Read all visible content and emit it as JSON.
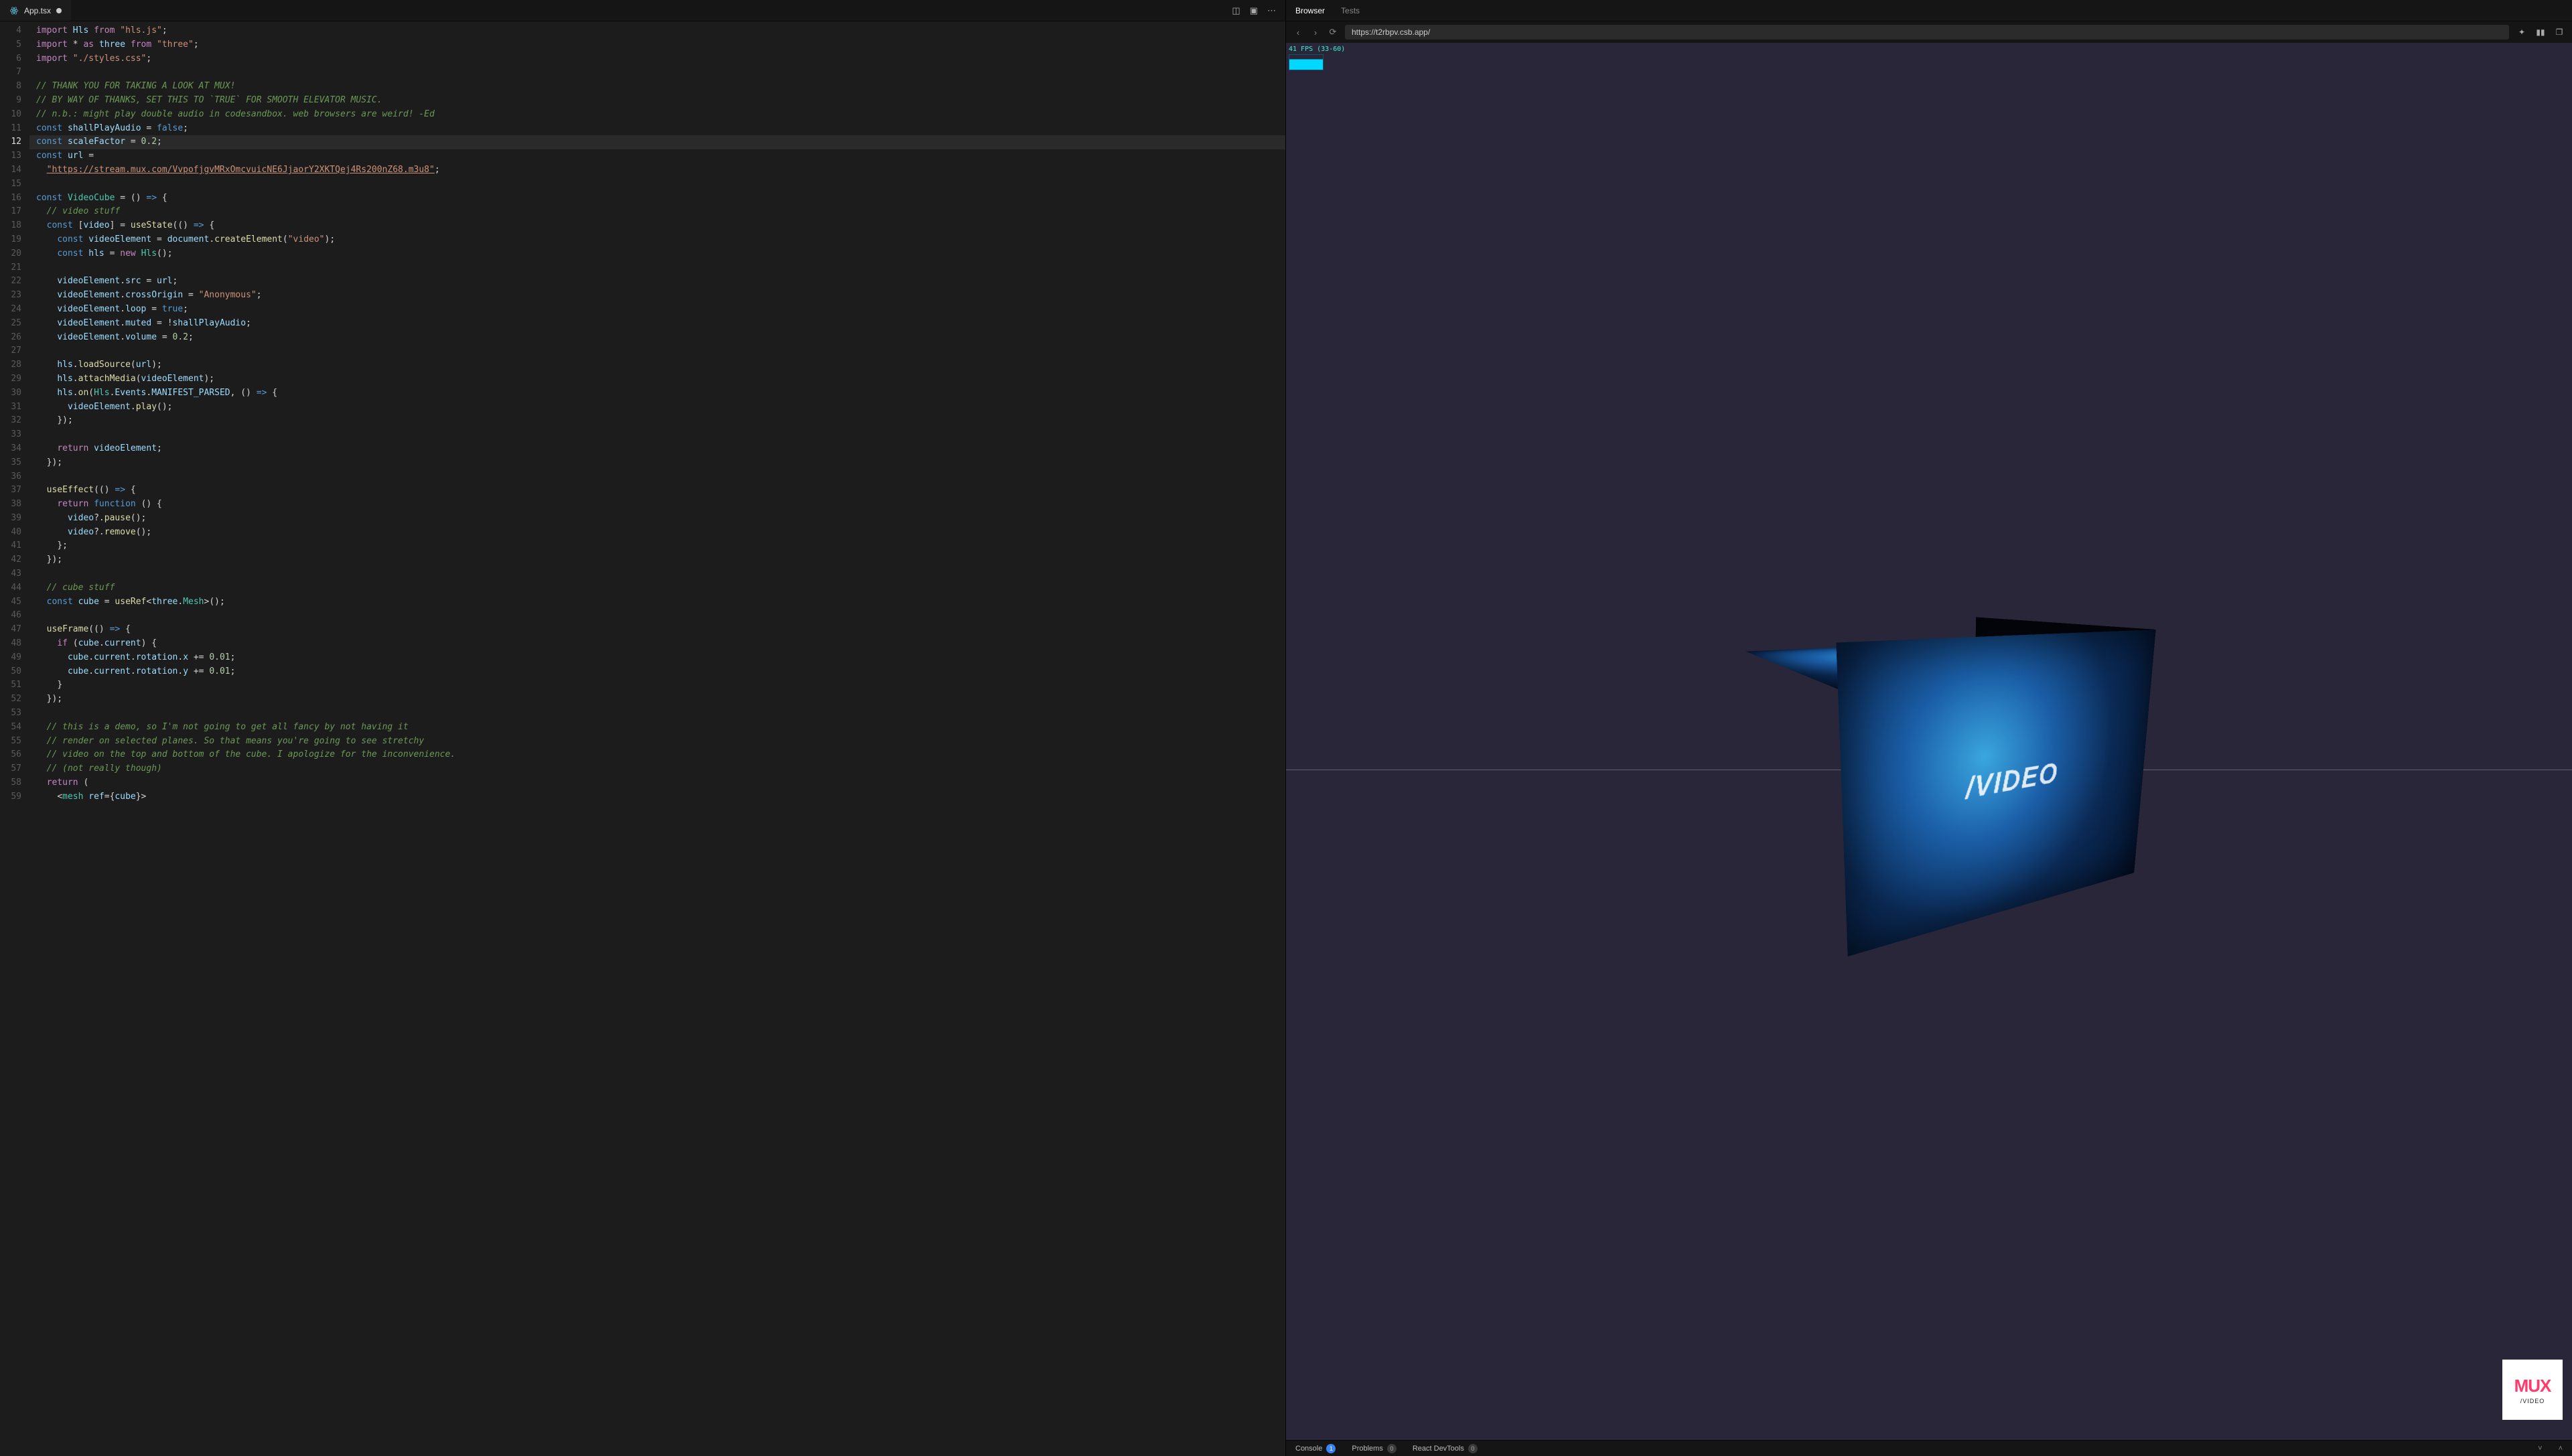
{
  "editor": {
    "tab": {
      "filename": "App.tsx",
      "modified": true
    },
    "activeLine": 12,
    "firstLine": 4,
    "lines": [
      {
        "n": 4,
        "html": "<span class='kw'>import</span> <span class='id'>Hls</span> <span class='kw'>from</span> <span class='str'>\"hls.js\"</span><span class='op'>;</span>"
      },
      {
        "n": 5,
        "html": "<span class='kw'>import</span> <span class='op'>*</span> <span class='kw'>as</span> <span class='id'>three</span> <span class='kw'>from</span> <span class='str'>\"three\"</span><span class='op'>;</span>"
      },
      {
        "n": 6,
        "html": "<span class='kw'>import</span> <span class='str'>\"./styles.css\"</span><span class='op'>;</span>"
      },
      {
        "n": 7,
        "html": ""
      },
      {
        "n": 8,
        "html": "<span class='com'>// THANK YOU FOR TAKING A LOOK AT MUX!</span>"
      },
      {
        "n": 9,
        "html": "<span class='com'>// BY WAY OF THANKS, SET THIS TO `TRUE` FOR SMOOTH ELEVATOR MUSIC.</span>"
      },
      {
        "n": 10,
        "html": "<span class='com'>// n.b.: might play double audio in codesandbox. web browsers are weird! -Ed</span>"
      },
      {
        "n": 11,
        "html": "<span class='kw2'>const</span> <span class='id'>shallPlayAudio</span> <span class='op'>=</span> <span class='kw2'>false</span><span class='op'>;</span>"
      },
      {
        "n": 12,
        "html": "<span class='kw2'>const</span> <span class='id'>scaleFactor</span> <span class='op'>=</span> <span class='num'>0.2</span><span class='op'>;</span>"
      },
      {
        "n": 13,
        "html": "<span class='kw2'>const</span> <span class='id'>url</span> <span class='op'>=</span>"
      },
      {
        "n": 14,
        "html": "  <span class='str url'>\"https://stream.mux.com/VvpofjgvMRxOmcvuicNE6JjaorY2XKTQej4Rs200nZ68.m3u8\"</span><span class='op'>;</span>"
      },
      {
        "n": 15,
        "html": ""
      },
      {
        "n": 16,
        "html": "<span class='kw2'>const</span> <span class='type'>VideoCube</span> <span class='op'>=</span> <span class='op'>()</span> <span class='kw2'>=&gt;</span> <span class='op'>{</span>"
      },
      {
        "n": 17,
        "html": "  <span class='com'>// video stuff</span>"
      },
      {
        "n": 18,
        "html": "  <span class='kw2'>const</span> <span class='op'>[</span><span class='id'>video</span><span class='op'>]</span> <span class='op'>=</span> <span class='fn'>useState</span><span class='op'>(()</span> <span class='kw2'>=&gt;</span> <span class='op'>{</span>"
      },
      {
        "n": 19,
        "html": "    <span class='kw2'>const</span> <span class='id'>videoElement</span> <span class='op'>=</span> <span class='id'>document</span><span class='op'>.</span><span class='fn'>createElement</span><span class='op'>(</span><span class='str'>\"video\"</span><span class='op'>);</span>"
      },
      {
        "n": 20,
        "html": "    <span class='kw2'>const</span> <span class='id'>hls</span> <span class='op'>=</span> <span class='kw'>new</span> <span class='type'>Hls</span><span class='op'>();</span>"
      },
      {
        "n": 21,
        "html": ""
      },
      {
        "n": 22,
        "html": "    <span class='id'>videoElement</span><span class='op'>.</span><span class='id'>src</span> <span class='op'>=</span> <span class='id'>url</span><span class='op'>;</span>"
      },
      {
        "n": 23,
        "html": "    <span class='id'>videoElement</span><span class='op'>.</span><span class='id'>crossOrigin</span> <span class='op'>=</span> <span class='str'>\"Anonymous\"</span><span class='op'>;</span>"
      },
      {
        "n": 24,
        "html": "    <span class='id'>videoElement</span><span class='op'>.</span><span class='id'>loop</span> <span class='op'>=</span> <span class='kw2'>true</span><span class='op'>;</span>"
      },
      {
        "n": 25,
        "html": "    <span class='id'>videoElement</span><span class='op'>.</span><span class='id'>muted</span> <span class='op'>=</span> <span class='op'>!</span><span class='id'>shallPlayAudio</span><span class='op'>;</span>"
      },
      {
        "n": 26,
        "html": "    <span class='id'>videoElement</span><span class='op'>.</span><span class='id'>volume</span> <span class='op'>=</span> <span class='num'>0.2</span><span class='op'>;</span>"
      },
      {
        "n": 27,
        "html": ""
      },
      {
        "n": 28,
        "html": "    <span class='id'>hls</span><span class='op'>.</span><span class='fn'>loadSource</span><span class='op'>(</span><span class='id'>url</span><span class='op'>);</span>"
      },
      {
        "n": 29,
        "html": "    <span class='id'>hls</span><span class='op'>.</span><span class='fn'>attachMedia</span><span class='op'>(</span><span class='id'>videoElement</span><span class='op'>);</span>"
      },
      {
        "n": 30,
        "html": "    <span class='id'>hls</span><span class='op'>.</span><span class='fn'>on</span><span class='op'>(</span><span class='type'>Hls</span><span class='op'>.</span><span class='id'>Events</span><span class='op'>.</span><span class='id'>MANIFEST_PARSED</span><span class='op'>, ()</span> <span class='kw2'>=&gt;</span> <span class='op'>{</span>"
      },
      {
        "n": 31,
        "html": "      <span class='id'>videoElement</span><span class='op'>.</span><span class='fn'>play</span><span class='op'>();</span>"
      },
      {
        "n": 32,
        "html": "    <span class='op'>});</span>"
      },
      {
        "n": 33,
        "html": ""
      },
      {
        "n": 34,
        "html": "    <span class='kw'>return</span> <span class='id'>videoElement</span><span class='op'>;</span>"
      },
      {
        "n": 35,
        "html": "  <span class='op'>});</span>"
      },
      {
        "n": 36,
        "html": ""
      },
      {
        "n": 37,
        "html": "  <span class='fn'>useEffect</span><span class='op'>(()</span> <span class='kw2'>=&gt;</span> <span class='op'>{</span>"
      },
      {
        "n": 38,
        "html": "    <span class='kw'>return</span> <span class='kw2'>function</span> <span class='op'>() {</span>"
      },
      {
        "n": 39,
        "html": "      <span class='id'>video</span><span class='op'>?.</span><span class='fn'>pause</span><span class='op'>();</span>"
      },
      {
        "n": 40,
        "html": "      <span class='id'>video</span><span class='op'>?.</span><span class='fn'>remove</span><span class='op'>();</span>"
      },
      {
        "n": 41,
        "html": "    <span class='op'>};</span>"
      },
      {
        "n": 42,
        "html": "  <span class='op'>});</span>"
      },
      {
        "n": 43,
        "html": ""
      },
      {
        "n": 44,
        "html": "  <span class='com'>// cube stuff</span>"
      },
      {
        "n": 45,
        "html": "  <span class='kw2'>const</span> <span class='id'>cube</span> <span class='op'>=</span> <span class='fn'>useRef</span><span class='op'>&lt;</span><span class='id'>three</span><span class='op'>.</span><span class='type'>Mesh</span><span class='op'>&gt;();</span>"
      },
      {
        "n": 46,
        "html": ""
      },
      {
        "n": 47,
        "html": "  <span class='fn'>useFrame</span><span class='op'>(()</span> <span class='kw2'>=&gt;</span> <span class='op'>{</span>"
      },
      {
        "n": 48,
        "html": "    <span class='kw'>if</span> <span class='op'>(</span><span class='id'>cube</span><span class='op'>.</span><span class='id'>current</span><span class='op'>) {</span>"
      },
      {
        "n": 49,
        "html": "      <span class='id'>cube</span><span class='op'>.</span><span class='id'>current</span><span class='op'>.</span><span class='id'>rotation</span><span class='op'>.</span><span class='id'>x</span> <span class='op'>+=</span> <span class='num'>0.01</span><span class='op'>;</span>"
      },
      {
        "n": 50,
        "html": "      <span class='id'>cube</span><span class='op'>.</span><span class='id'>current</span><span class='op'>.</span><span class='id'>rotation</span><span class='op'>.</span><span class='id'>y</span> <span class='op'>+=</span> <span class='num'>0.01</span><span class='op'>;</span>"
      },
      {
        "n": 51,
        "html": "    <span class='op'>}</span>"
      },
      {
        "n": 52,
        "html": "  <span class='op'>});</span>"
      },
      {
        "n": 53,
        "html": ""
      },
      {
        "n": 54,
        "html": "  <span class='com'>// this is a demo, so I'm not going to get all fancy by not having it</span>"
      },
      {
        "n": 55,
        "html": "  <span class='com'>// render on selected planes. So that means you're going to see stretchy</span>"
      },
      {
        "n": 56,
        "html": "  <span class='com'>// video on the top and bottom of the cube. I apologize for the inconvenience.</span>"
      },
      {
        "n": 57,
        "html": "  <span class='com'>// (not really though)</span>"
      },
      {
        "n": 58,
        "html": "  <span class='kw'>return</span> <span class='op'>(</span>"
      },
      {
        "n": 59,
        "html": "    <span class='op'>&lt;</span><span class='type'>mesh</span> <span class='id'>ref</span><span class='op'>={</span><span class='id'>cube</span><span class='op'>}&gt;</span>"
      }
    ]
  },
  "preview": {
    "tabs": {
      "browser": "Browser",
      "tests": "Tests"
    },
    "url": "https://t2rbpv.csb.app/",
    "fps": "41 FPS (33-60)",
    "faceText": "/VIDEO",
    "logo": {
      "brand": "MUX",
      "sub": "/VIDEO"
    }
  },
  "console": {
    "items": [
      {
        "label": "Console",
        "count": "1",
        "badge": "blue"
      },
      {
        "label": "Problems",
        "count": "0",
        "badge": "gray"
      },
      {
        "label": "React DevTools",
        "count": "0",
        "badge": "gray"
      }
    ]
  }
}
